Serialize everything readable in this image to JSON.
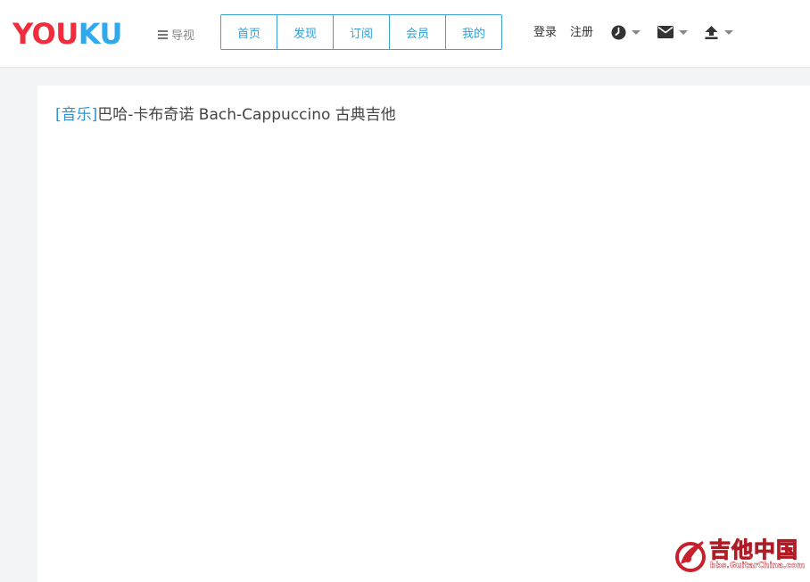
{
  "header": {
    "logo": {
      "part1": "YOU",
      "part2": "KU"
    },
    "nav_toggle_label": "导视",
    "tabs": [
      {
        "label": "首页"
      },
      {
        "label": "发现"
      },
      {
        "label": "订阅"
      },
      {
        "label": "会员"
      },
      {
        "label": "我的"
      }
    ],
    "login_label": "登录",
    "register_label": "注册",
    "tools": [
      {
        "icon": "history-clock-icon"
      },
      {
        "icon": "envelope-icon"
      },
      {
        "icon": "upload-icon"
      }
    ]
  },
  "video": {
    "category": "[音乐]",
    "title": "巴哈-卡布奇诺 Bach-Cappuccino 古典吉他"
  },
  "watermark": {
    "text": "吉他中国",
    "url": "bbs.GuitarChina.com"
  },
  "colors": {
    "accent_blue": "#2f9fd6",
    "logo_red": "#ef2d3d",
    "logo_blue": "#2fa9ee",
    "page_background": "#f2f3f5"
  }
}
